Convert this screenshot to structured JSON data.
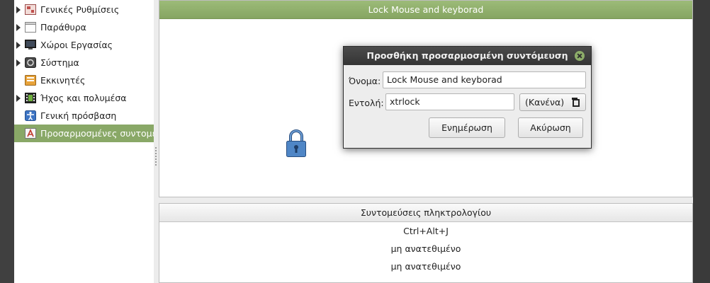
{
  "sidebar": {
    "items": [
      {
        "label": "Γενικές Ρυθμίσεις",
        "icon": "general-settings-icon",
        "expandable": true
      },
      {
        "label": "Παράθυρα",
        "icon": "window-icon",
        "expandable": true
      },
      {
        "label": "Χώροι Εργασίας",
        "icon": "workspace-icon",
        "expandable": true
      },
      {
        "label": "Σύστημα",
        "icon": "system-icon",
        "expandable": true
      },
      {
        "label": "Εκκινητές",
        "icon": "launcher-icon",
        "expandable": false
      },
      {
        "label": "Ήχος και πολυμέσα",
        "icon": "sound-media-icon",
        "expandable": true
      },
      {
        "label": "Γενική πρόσβαση",
        "icon": "accessibility-icon",
        "expandable": false
      },
      {
        "label": "Προσαρμοσμένες συντομεύσεις",
        "icon": "custom-shortcut-icon",
        "expandable": false,
        "selected": true
      }
    ]
  },
  "main": {
    "shortcut_title": "Lock Mouse and keyborad",
    "shortcut_icon": "lock-icon",
    "keyboard_header": "Συντομεύσεις πληκτρολογίου",
    "bindings": [
      "Ctrl+Alt+J",
      "μη ανατεθιμένο",
      "μη ανατεθιμένο"
    ]
  },
  "dialog": {
    "title": "Προσθήκη προσαρμοσμένη συντόμευση",
    "name_label": "Όνομα:",
    "name_value": "Lock Mouse and keyborad",
    "command_label": "Εντολή:",
    "command_value": "xtrlock",
    "none_button": "(Κανένα)",
    "update_button": "Ενημέρωση",
    "cancel_button": "Ακύρωση"
  },
  "colors": {
    "accent": "#89a867",
    "titlebar": "#3d3d3d",
    "background": "#ececec"
  }
}
